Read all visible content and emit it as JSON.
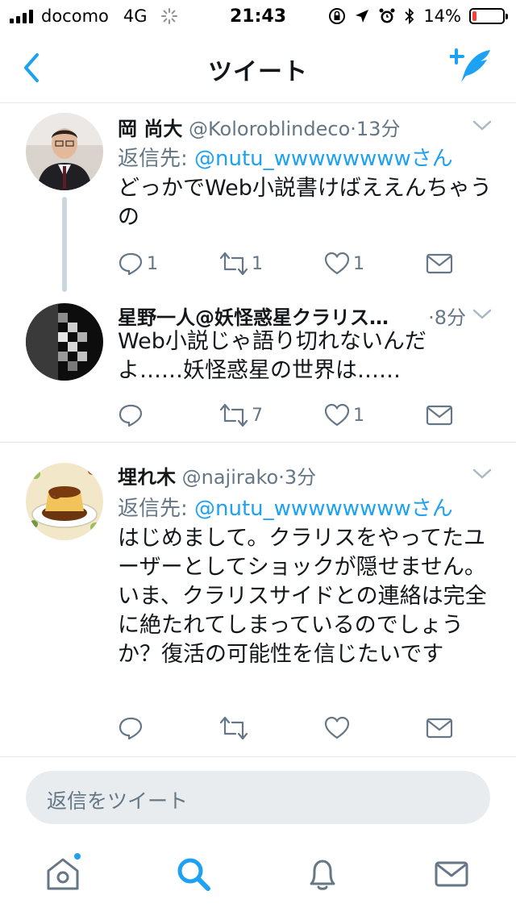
{
  "status_bar": {
    "carrier": "docomo",
    "network": "4G",
    "time": "21:43",
    "battery": "14%",
    "battery_level": 0.14
  },
  "nav": {
    "title": "ツイート",
    "back_icon": "chevron-left-icon",
    "compose_icon": "compose-tweet-icon"
  },
  "tweets": [
    {
      "name": "岡 尚大",
      "handle": "@Koloroblindeco",
      "sep": "·",
      "time": "13分",
      "reply_label": "返信先:",
      "reply_mention": "@nutu_wwwwwwwwさん",
      "text": "どっかでWeb小説書けばええんちゃうの",
      "replies": "1",
      "retweets": "1",
      "likes": "1"
    },
    {
      "name": "星野一人@妖怪惑星クラリス…",
      "handle": "",
      "sep": "·",
      "time": "8分",
      "text": "Web小説じゃ語り切れないんだよ……妖怪惑星の世界は……",
      "replies": "",
      "retweets": "7",
      "likes": "1"
    },
    {
      "name": "埋れ木",
      "handle": "@najirako",
      "sep": "·",
      "time": "3分",
      "reply_label": "返信先:",
      "reply_mention": "@nutu_wwwwwwwwさん",
      "text": "はじめまして。クラリスをやってたユーザーとしてショックが隠せません。いま、クラリスサイドとの連絡は完全に絶たれてしまっているのでしょうか？復活の可能性を信じたいです",
      "replies": "",
      "retweets": "",
      "likes": ""
    }
  ],
  "reply_bar": {
    "placeholder": "返信をツイート"
  },
  "tab_bar": {
    "items": [
      "home-icon",
      "search-icon",
      "notifications-icon",
      "messages-icon"
    ],
    "active": "search-icon",
    "accent": "#1da1f2"
  },
  "colors": {
    "accent": "#1da1f2",
    "muted": "#657786",
    "text": "#14171a",
    "divider": "#e1e8ed"
  }
}
